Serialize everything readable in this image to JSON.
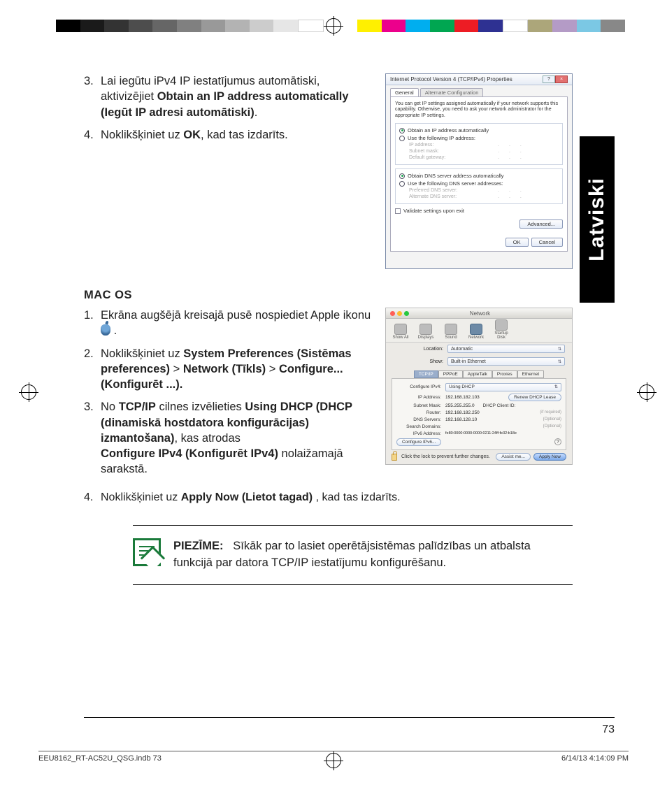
{
  "print": {
    "footer_left": "EEU8162_RT-AC52U_QSG.indb   73",
    "footer_right": "6/14/13   4:14:09 PM"
  },
  "side_tab": "Latviski",
  "section1": {
    "items": [
      {
        "num": "3.",
        "pre": "Lai iegūtu iPv4 IP iestatījumus automātiski, aktivizējiet ",
        "bold": "Obtain an IP address automatically (Iegūt IP adresi automātiski)",
        "post": "."
      },
      {
        "num": "4.",
        "pre": "Noklikšķiniet uz ",
        "bold": "OK",
        "post": ", kad tas izdarīts."
      }
    ]
  },
  "win": {
    "title": "Internet Protocol Version 4 (TCP/IPv4) Properties",
    "tab1": "General",
    "tab2": "Alternate Configuration",
    "desc": "You can get IP settings assigned automatically if your network supports this capability. Otherwise, you need to ask your network administrator for the appropriate IP settings.",
    "r1": "Obtain an IP address automatically",
    "r2": "Use the following IP address:",
    "f1": "IP address:",
    "f2": "Subnet mask:",
    "f3": "Default gateway:",
    "r3": "Obtain DNS server address automatically",
    "r4": "Use the following DNS server addresses:",
    "f4": "Preferred DNS server:",
    "f5": "Alternate DNS server:",
    "chk": "Validate settings upon exit",
    "adv": "Advanced...",
    "ok": "OK",
    "cancel": "Cancel"
  },
  "mac_heading": "MAC OS",
  "section2": {
    "items": [
      {
        "num": "1.",
        "text_a": "Ekrāna augšējā kreisajā pusē nospiediet Apple ikonu ",
        "text_b": " ."
      },
      {
        "num": "2.",
        "pre": "Noklikšķiniet uz ",
        "b1": "System Preferences (Sistēmas preferences)",
        "gt1": " > ",
        "b2": "Network (Tīkls)",
        "gt2": " > ",
        "b3": "Configure... (Konfigurēt ...)."
      },
      {
        "num": "3.",
        "pre": "No ",
        "b1": "TCP/IP",
        "mid1": " cilnes izvēlieties ",
        "b2": "Using DHCP (DHCP (dinamiskā hostdatora konfigurācijas) izmantošana)",
        "mid2": ", kas atrodas ",
        "b3": "Configure IPv4 (Konfigurēt IPv4)",
        "post": " nolaižamajā sarakstā."
      },
      {
        "num": "4.",
        "pre": "Noklikšķiniet uz ",
        "b1": "Apply Now (Lietot tagad)",
        "post": " , kad tas izdarīts."
      }
    ]
  },
  "mac": {
    "title": "Network",
    "icons": [
      "Show All",
      "Displays",
      "Sound",
      "Network",
      "Startup Disk"
    ],
    "loc_l": "Location:",
    "loc_v": "Automatic",
    "show_l": "Show:",
    "show_v": "Built-in Ethernet",
    "tabs": [
      "TCP/IP",
      "PPPoE",
      "AppleTalk",
      "Proxies",
      "Ethernet"
    ],
    "cfg_l": "Configure IPv4:",
    "cfg_v": "Using DHCP",
    "ip_l": "IP Address:",
    "ip_v": "192.168.182.103",
    "renew": "Renew DHCP Lease",
    "sm_l": "Subnet Mask:",
    "sm_v": "255.255.255.0",
    "cid_l": "DHCP Client ID:",
    "cid_hint": "(if required)",
    "rt_l": "Router:",
    "rt_v": "192.168.182.250",
    "dns_l": "DNS Servers:",
    "dns_v": "192.168.128.10",
    "sd_l": "Search Domains:",
    "v6_l": "IPv6 Address:",
    "v6_v": "fe80:0000:0000:0000:0211:24ff:fe32:b18e",
    "cfg6": "Configure IPv6...",
    "opt": "(Optional)",
    "lock": "Click the lock to prevent further changes.",
    "assist": "Assist me...",
    "apply": "Apply Now"
  },
  "note": {
    "label": "PIEZĪME:",
    "text": "Sīkāk par to lasiet operētājsistēmas palīdzības un atbalsta funkcijā par datora TCP/IP iestatījumu konfigurēšanu."
  },
  "page_num": "73"
}
